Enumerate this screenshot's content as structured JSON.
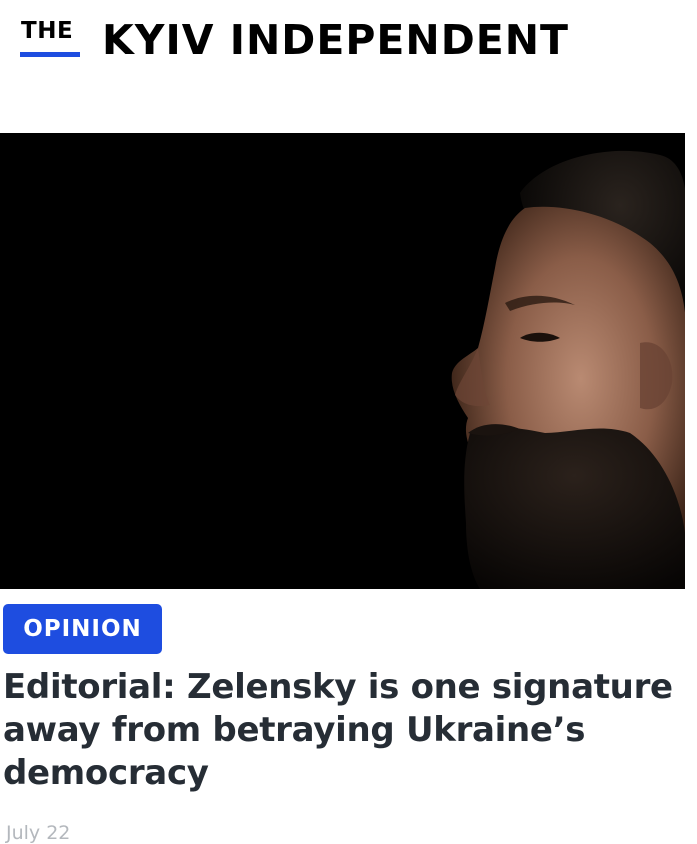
{
  "masthead": {
    "the_text": "THE",
    "name": "KYIV INDEPENDENT",
    "accent_color": "#1e4de0"
  },
  "hero_image": {
    "description_icon": "portrait-photo"
  },
  "article": {
    "category": "OPINION",
    "headline": "Editorial: Zelensky is one signature away from betraying Ukraine’s democracy",
    "date": "July 22"
  },
  "colors": {
    "tag_background": "#1e4de0",
    "headline": "#262d35",
    "date": "#b4b8bd"
  }
}
